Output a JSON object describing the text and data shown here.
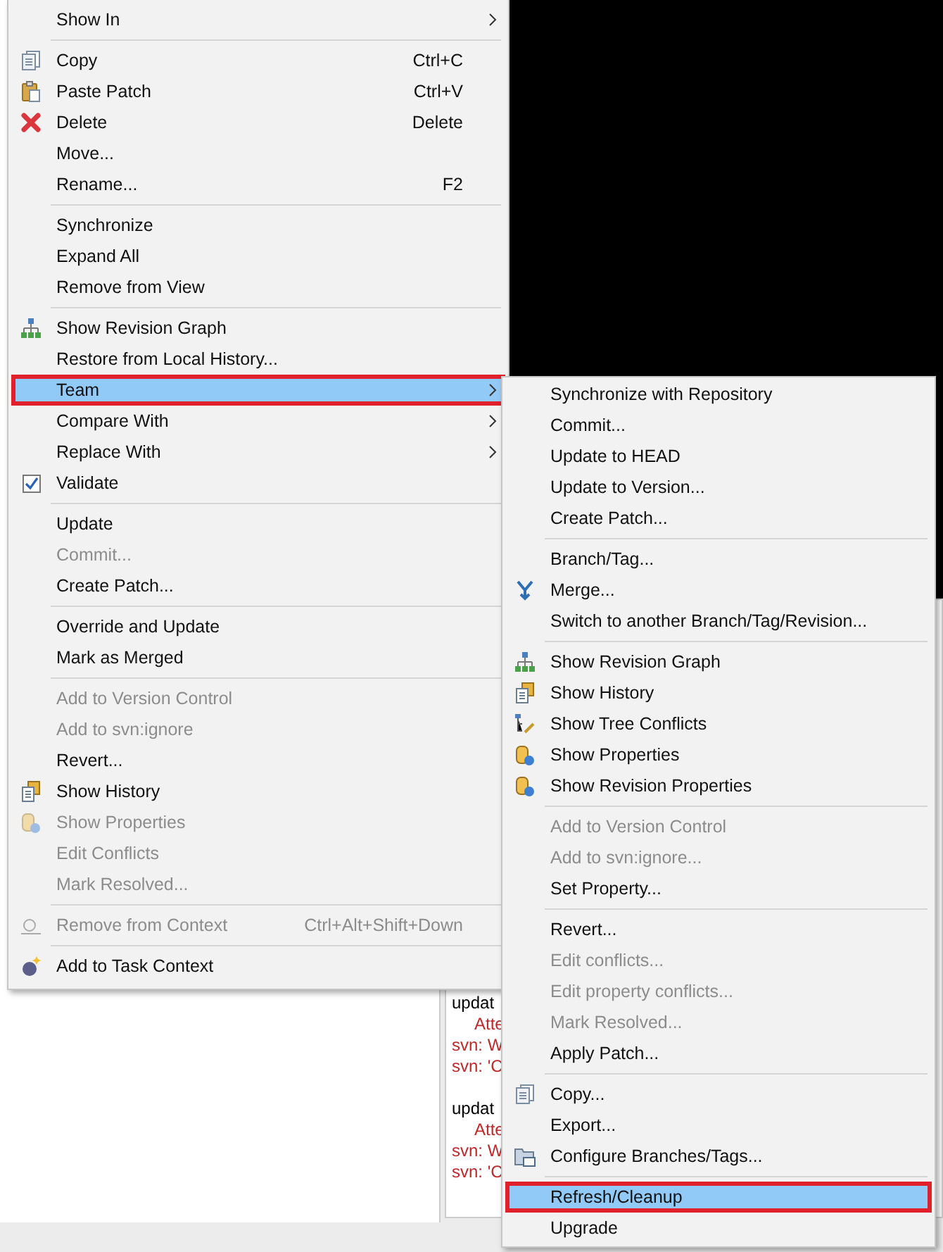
{
  "main_menu": {
    "items": [
      {
        "kind": "item",
        "label": "Show In",
        "has_submenu": true,
        "disabled": false,
        "selected": false
      },
      {
        "kind": "separator"
      },
      {
        "kind": "copy",
        "label": "Copy",
        "shortcut": "Ctrl+C",
        "has_submenu": false,
        "disabled": false,
        "selected": false
      },
      {
        "kind": "paste",
        "label": "Paste Patch",
        "shortcut": "Ctrl+V",
        "has_submenu": false,
        "disabled": false,
        "selected": false
      },
      {
        "kind": "delete",
        "label": "Delete",
        "shortcut": "Delete",
        "has_submenu": false,
        "disabled": false,
        "selected": false
      },
      {
        "kind": "item",
        "label": "Move...",
        "has_submenu": false,
        "disabled": false,
        "selected": false
      },
      {
        "kind": "item",
        "label": "Rename...",
        "shortcut": "F2",
        "has_submenu": false,
        "disabled": false,
        "selected": false
      },
      {
        "kind": "separator"
      },
      {
        "kind": "item",
        "label": "Synchronize",
        "has_submenu": false,
        "disabled": false,
        "selected": false
      },
      {
        "kind": "item",
        "label": "Expand All",
        "has_submenu": false,
        "disabled": false,
        "selected": false
      },
      {
        "kind": "item",
        "label": "Remove from View",
        "has_submenu": false,
        "disabled": false,
        "selected": false
      },
      {
        "kind": "separator"
      },
      {
        "kind": "graph",
        "label": "Show Revision Graph",
        "has_submenu": false,
        "disabled": false,
        "selected": false
      },
      {
        "kind": "item",
        "label": "Restore from Local History...",
        "has_submenu": false,
        "disabled": false,
        "selected": false
      },
      {
        "kind": "item",
        "label": "Team",
        "has_submenu": true,
        "disabled": false,
        "selected": true
      },
      {
        "kind": "item",
        "label": "Compare With",
        "has_submenu": true,
        "disabled": false,
        "selected": false
      },
      {
        "kind": "item",
        "label": "Replace With",
        "has_submenu": true,
        "disabled": false,
        "selected": false
      },
      {
        "kind": "checkbox",
        "label": "Validate",
        "checked": true,
        "has_submenu": false,
        "disabled": false,
        "selected": false
      },
      {
        "kind": "separator"
      },
      {
        "kind": "item",
        "label": "Update",
        "has_submenu": false,
        "disabled": false,
        "selected": false
      },
      {
        "kind": "item",
        "label": "Commit...",
        "has_submenu": false,
        "disabled": true,
        "selected": false
      },
      {
        "kind": "item",
        "label": "Create Patch...",
        "has_submenu": false,
        "disabled": false,
        "selected": false
      },
      {
        "kind": "separator"
      },
      {
        "kind": "item",
        "label": "Override and Update",
        "has_submenu": false,
        "disabled": false,
        "selected": false
      },
      {
        "kind": "item",
        "label": "Mark as Merged",
        "has_submenu": false,
        "disabled": false,
        "selected": false
      },
      {
        "kind": "separator"
      },
      {
        "kind": "item",
        "label": "Add to Version Control",
        "has_submenu": false,
        "disabled": true,
        "selected": false
      },
      {
        "kind": "item",
        "label": "Add to svn:ignore",
        "has_submenu": false,
        "disabled": true,
        "selected": false
      },
      {
        "kind": "item",
        "label": "Revert...",
        "has_submenu": false,
        "disabled": false,
        "selected": false
      },
      {
        "kind": "history",
        "label": "Show History",
        "has_submenu": false,
        "disabled": false,
        "selected": false
      },
      {
        "kind": "properties",
        "label": "Show Properties",
        "has_submenu": false,
        "disabled": true,
        "selected": false
      },
      {
        "kind": "item",
        "label": "Edit Conflicts",
        "has_submenu": false,
        "disabled": true,
        "selected": false
      },
      {
        "kind": "item",
        "label": "Mark Resolved...",
        "has_submenu": false,
        "disabled": true,
        "selected": false
      },
      {
        "kind": "separator"
      },
      {
        "kind": "unlink",
        "label": "Remove from Context",
        "shortcut": "Ctrl+Alt+Shift+Down",
        "has_submenu": false,
        "disabled": true,
        "selected": false
      },
      {
        "kind": "separator"
      },
      {
        "kind": "context",
        "label": "Add to Task Context",
        "has_submenu": false,
        "disabled": false,
        "selected": false
      }
    ]
  },
  "team_submenu": {
    "items": [
      {
        "kind": "item",
        "label": "Synchronize with Repository",
        "disabled": false,
        "selected": false
      },
      {
        "kind": "item",
        "label": "Commit...",
        "disabled": false,
        "selected": false
      },
      {
        "kind": "item",
        "label": "Update to HEAD",
        "disabled": false,
        "selected": false
      },
      {
        "kind": "item",
        "label": "Update to Version...",
        "disabled": false,
        "selected": false
      },
      {
        "kind": "item",
        "label": "Create Patch...",
        "disabled": false,
        "selected": false
      },
      {
        "kind": "separator"
      },
      {
        "kind": "item",
        "label": "Branch/Tag...",
        "disabled": false,
        "selected": false
      },
      {
        "kind": "merge",
        "label": "Merge...",
        "disabled": false,
        "selected": false
      },
      {
        "kind": "item",
        "label": "Switch to another Branch/Tag/Revision...",
        "disabled": false,
        "selected": false
      },
      {
        "kind": "separator"
      },
      {
        "kind": "graph",
        "label": "Show Revision Graph",
        "disabled": false,
        "selected": false
      },
      {
        "kind": "history",
        "label": "Show History",
        "disabled": false,
        "selected": false
      },
      {
        "kind": "tree",
        "label": "Show Tree Conflicts",
        "disabled": false,
        "selected": false
      },
      {
        "kind": "properties",
        "label": "Show Properties",
        "disabled": false,
        "selected": false
      },
      {
        "kind": "properties",
        "label": "Show Revision Properties",
        "disabled": false,
        "selected": false
      },
      {
        "kind": "separator"
      },
      {
        "kind": "item",
        "label": "Add to Version Control",
        "disabled": true,
        "selected": false
      },
      {
        "kind": "item",
        "label": "Add to svn:ignore...",
        "disabled": true,
        "selected": false
      },
      {
        "kind": "item",
        "label": "Set Property...",
        "disabled": false,
        "selected": false
      },
      {
        "kind": "separator"
      },
      {
        "kind": "item",
        "label": "Revert...",
        "disabled": false,
        "selected": false
      },
      {
        "kind": "item",
        "label": "Edit conflicts...",
        "disabled": true,
        "selected": false
      },
      {
        "kind": "item",
        "label": "Edit property conflicts...",
        "disabled": true,
        "selected": false
      },
      {
        "kind": "item",
        "label": "Mark Resolved...",
        "disabled": true,
        "selected": false
      },
      {
        "kind": "item",
        "label": "Apply Patch...",
        "disabled": false,
        "selected": false
      },
      {
        "kind": "separator"
      },
      {
        "kind": "copy",
        "label": "Copy...",
        "disabled": false,
        "selected": false
      },
      {
        "kind": "item",
        "label": "Export...",
        "disabled": false,
        "selected": false
      },
      {
        "kind": "branches",
        "label": "Configure Branches/Tags...",
        "disabled": false,
        "selected": false
      },
      {
        "kind": "separator"
      },
      {
        "kind": "item",
        "label": "Refresh/Cleanup",
        "disabled": false,
        "selected": true
      },
      {
        "kind": "item",
        "label": "Upgrade",
        "disabled": false,
        "selected": false
      }
    ]
  },
  "console": {
    "lines": [
      {
        "text": "updat",
        "kind": "plain"
      },
      {
        "text": "Atte",
        "kind": "indented"
      },
      {
        "text": "svn: W",
        "kind": "error"
      },
      {
        "text": "svn: 'C",
        "kind": "error"
      },
      {
        "kind": "blank"
      },
      {
        "text": "updat",
        "kind": "plain"
      },
      {
        "text": "Atte",
        "kind": "indented"
      },
      {
        "text": "svn: W",
        "kind": "error"
      },
      {
        "text": "svn: 'C",
        "kind": "error"
      }
    ]
  }
}
